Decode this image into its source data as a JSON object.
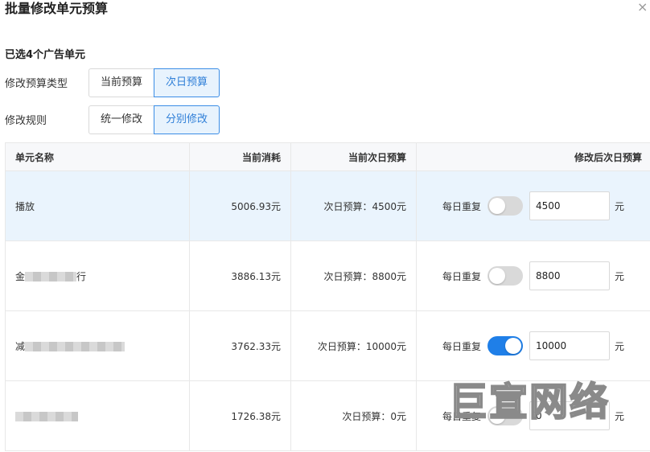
{
  "dialog": {
    "title": "批量修改单元预算",
    "close_glyph": "×"
  },
  "selected_text": "已选4个广告单元",
  "budget_type": {
    "label": "修改预算类型",
    "options": [
      "当前预算",
      "次日预算"
    ],
    "selected": "次日预算"
  },
  "rule": {
    "label": "修改规则",
    "options": [
      "统一修改",
      "分别修改"
    ],
    "selected": "分别修改"
  },
  "table": {
    "columns": [
      "单元名称",
      "当前消耗",
      "当前次日预算",
      "修改后次日预算"
    ],
    "repeat_label": "每日重复",
    "unit": "元",
    "rows": [
      {
        "name": "播放",
        "cost": "5006.93元",
        "next_budget": "次日预算：4500元",
        "repeat": false,
        "value": "4500",
        "highlighted": true
      },
      {
        "name": "金",
        "name_suffix": "行",
        "cost": "3886.13元",
        "next_budget": "次日预算：8800元",
        "repeat": false,
        "value": "8800",
        "highlighted": false
      },
      {
        "name": "减",
        "cost": "3762.33元",
        "next_budget": "次日预算：10000元",
        "repeat": true,
        "value": "10000",
        "highlighted": false
      },
      {
        "name": "",
        "cost": "1726.38元",
        "next_budget": "次日预算：0元",
        "repeat": false,
        "value": "0",
        "highlighted": false
      }
    ]
  },
  "watermark": "巨宣网络",
  "colors": {
    "accent": "#2f7fd8",
    "accent_bg": "#e8f3fd",
    "toggle_on": "#1f7fe8",
    "toggle_off": "#d9d9d9",
    "row_highlight": "#eaf4fd",
    "header_bg": "#f7f8fa"
  },
  "icons": {
    "close": "close-icon"
  }
}
